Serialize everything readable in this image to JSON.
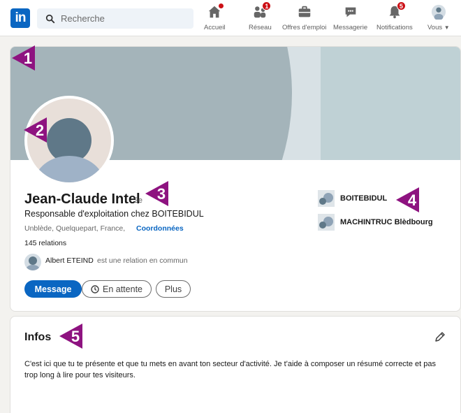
{
  "nav": {
    "search_placeholder": "Recherche",
    "items": [
      {
        "label": "Accueil",
        "icon": "home-icon",
        "badge": ""
      },
      {
        "label": "Réseau",
        "icon": "network-icon",
        "badge": "1"
      },
      {
        "label": "Offres d'emploi",
        "icon": "briefcase-icon",
        "badge": ""
      },
      {
        "label": "Messagerie",
        "icon": "messaging-icon",
        "badge": ""
      },
      {
        "label": "Notifications",
        "icon": "bell-icon",
        "badge": "5"
      },
      {
        "label": "Vous",
        "icon": "me-avatar-icon",
        "badge": ""
      }
    ]
  },
  "profile": {
    "name": "Jean-Claude Intel",
    "degree": "· 2e",
    "headline": "Responsable d'exploitation chez BOITEBIDUL",
    "location": "Unblède, Quelquepart, France,",
    "contact_link": "Coordonnées",
    "relations": "145 relations",
    "mutual_name": "Albert ETEIND",
    "mutual_rest": "est une relation en commun",
    "buttons": {
      "message": "Message",
      "pending": "En attente",
      "more": "Plus"
    },
    "organizations": [
      {
        "name": "BOITEBIDUL"
      },
      {
        "name": "MACHINTRUC Blèdbourg"
      }
    ]
  },
  "about": {
    "title": "Infos",
    "text": "C'est ici que tu te présente et que tu mets en avant ton secteur d'activité. Je t'aide à composer un résumé correcte et pas trop long à lire pour tes visiteurs."
  },
  "annotations": [
    "1",
    "2",
    "3",
    "4",
    "5"
  ],
  "colors": {
    "brand": "#0a66c2",
    "badge": "#cc1016",
    "marker": "#8e1380"
  }
}
